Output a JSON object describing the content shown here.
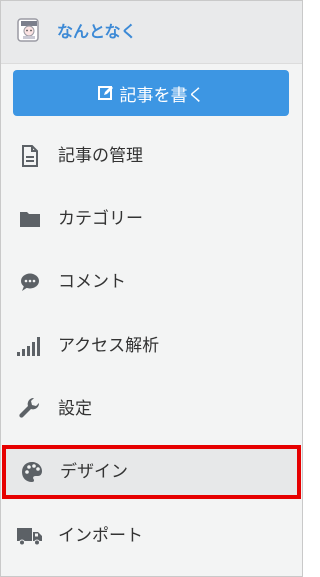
{
  "header": {
    "blog_title": "なんとなく"
  },
  "write_button": {
    "label": "記事を書く"
  },
  "menu": [
    {
      "label": "記事の管理",
      "icon": "document-icon"
    },
    {
      "label": "カテゴリー",
      "icon": "folder-icon"
    },
    {
      "label": "コメント",
      "icon": "comment-icon"
    },
    {
      "label": "アクセス解析",
      "icon": "signal-bars-icon"
    },
    {
      "label": "設定",
      "icon": "wrench-icon"
    },
    {
      "label": "デザイン",
      "icon": "palette-icon"
    },
    {
      "label": "インポート",
      "icon": "truck-icon"
    }
  ],
  "colors": {
    "accent": "#3d8ad6",
    "button": "#3d96e3",
    "highlight_border": "#e60000"
  }
}
